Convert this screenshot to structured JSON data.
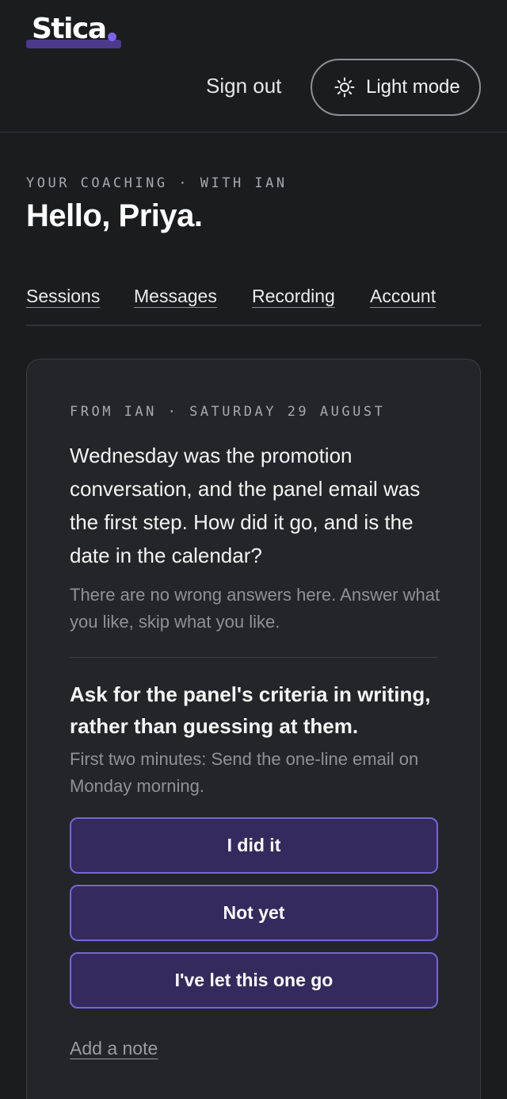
{
  "brand": {
    "name": "Stica",
    "accent": "#7b63f0",
    "underline_color": "#4a3a8c"
  },
  "header": {
    "sign_out_label": "Sign out",
    "theme_toggle_label": "Light mode",
    "theme_toggle_icon": "sun-icon"
  },
  "greeting": {
    "eyebrow": "YOUR COACHING · WITH IAN",
    "title": "Hello, Priya."
  },
  "tabs": [
    {
      "label": "Sessions"
    },
    {
      "label": "Messages"
    },
    {
      "label": "Recording"
    },
    {
      "label": "Account"
    }
  ],
  "checkin": {
    "eyebrow": "FROM IAN · SATURDAY 29 AUGUST",
    "question": "Wednesday was the promotion conversation, and the panel email was the first step. How did it go, and is the date in the calendar?",
    "reassurance": "There are no wrong answers here. Answer what you like, skip what you like.",
    "action_title": "Ask for the panel's criteria in writing, rather than guessing at them.",
    "action_detail": "First two minutes: Send the one-line email on Monday morning.",
    "choices": [
      {
        "label": "I did it"
      },
      {
        "label": "Not yet"
      },
      {
        "label": "I've let this one go"
      }
    ],
    "add_note_label": "Add a note",
    "choice_color": "#342a5e",
    "choice_border_color": "#7465d8"
  }
}
